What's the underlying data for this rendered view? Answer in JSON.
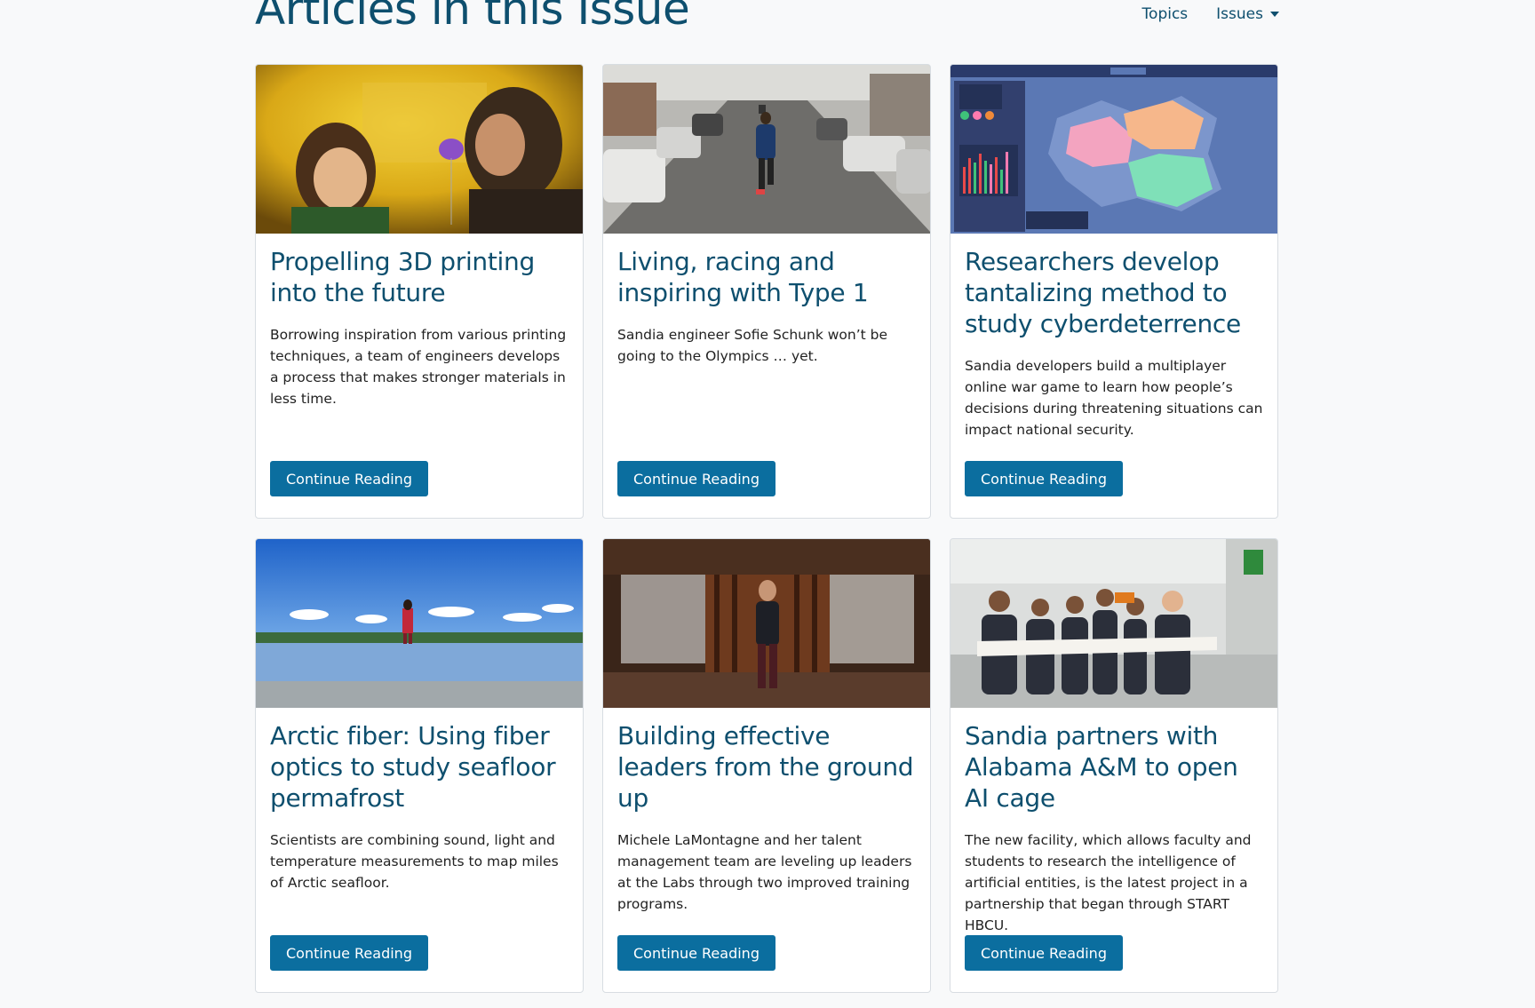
{
  "header": {
    "title": "Articles in this Issue",
    "nav": {
      "topics": "Topics",
      "issues": "Issues"
    }
  },
  "articles": [
    {
      "title": "Propelling 3D printing into the future",
      "summary": "Borrowing inspiration from various printing techniques, a team of engineers develops a process that makes stronger materials in less time.",
      "button": "Continue Reading"
    },
    {
      "title": "Living, racing and inspiring with Type 1",
      "summary": "Sandia engineer Sofie Schunk won’t be going to the Olympics … yet.",
      "button": "Continue Reading"
    },
    {
      "title": "Researchers develop tantalizing method to study cyberdeterrence",
      "summary": "Sandia developers build a multiplayer online war game to learn how people’s decisions during threatening situations can impact national security.",
      "button": "Continue Reading"
    },
    {
      "title": "Arctic fiber: Using fiber optics to study seafloor permafrost",
      "summary": "Scientists are combining sound, light and temperature measurements to map miles of Arctic seafloor.",
      "button": "Continue Reading"
    },
    {
      "title": "Building effective leaders from the ground up",
      "summary": "Michele LaMontagne and her talent management team are leveling up leaders at the Labs through two improved training programs.",
      "button": "Continue Reading"
    },
    {
      "title": "Sandia partners with Alabama A&M to open AI cage",
      "summary": "The new facility, which allows faculty and students to research the intelligence of artificial entities, is the latest project in a partnership that began through START HBCU.",
      "button": "Continue Reading"
    }
  ],
  "colors": {
    "accent": "#0e4f6e",
    "button": "#0b6e9f",
    "background": "#f8f9fa"
  }
}
